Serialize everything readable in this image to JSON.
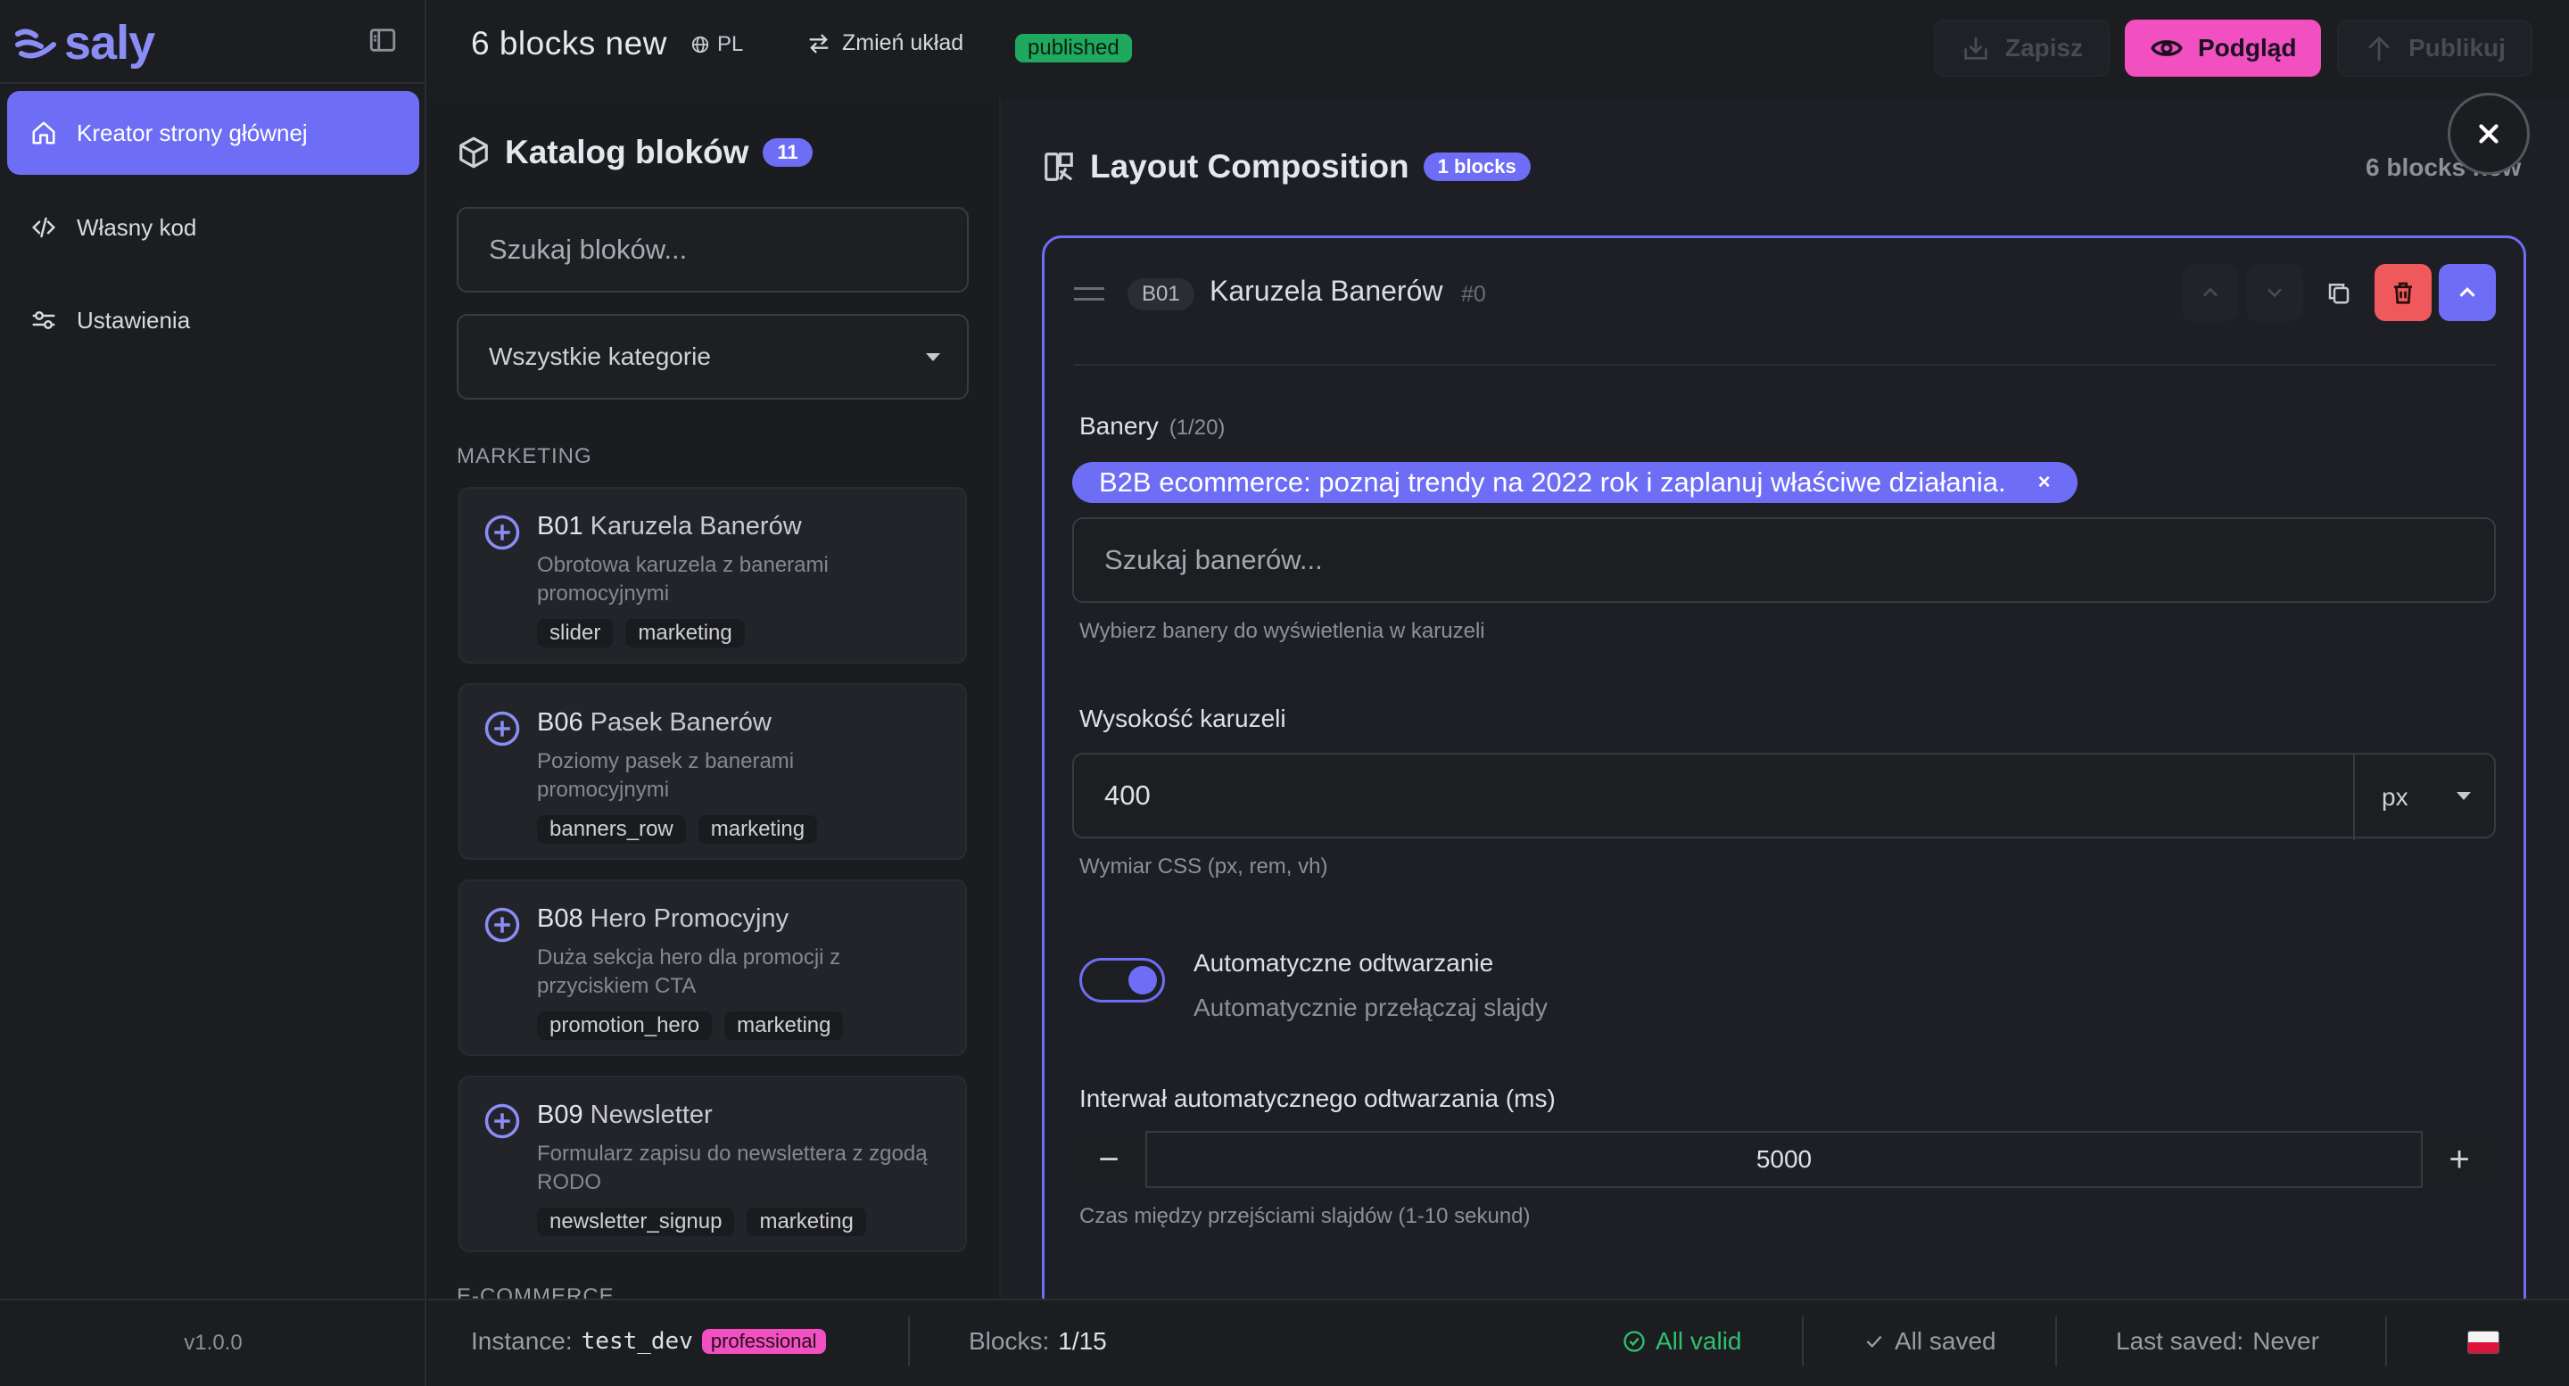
{
  "app": {
    "logo_text": "saly",
    "version": "v1.0.0"
  },
  "sidebar": {
    "items": [
      {
        "label": "Kreator strony głównej",
        "icon": "home-icon",
        "active": true
      },
      {
        "label": "Własny kod",
        "icon": "code-icon",
        "active": false
      },
      {
        "label": "Ustawienia",
        "icon": "sliders-icon",
        "active": false
      }
    ]
  },
  "header": {
    "title": "6 blocks new",
    "language": "PL",
    "change_layout": "Zmień układ",
    "status": "published",
    "save_label": "Zapisz",
    "preview_label": "Podgląd",
    "publish_label": "Publikuj"
  },
  "catalog": {
    "title": "Katalog bloków",
    "count": "11",
    "search_placeholder": "Szukaj bloków...",
    "category_select": "Wszystkie kategorie",
    "section_marketing": "MARKETING",
    "section_ecommerce": "E-COMMERCE",
    "blocks": [
      {
        "code": "B01",
        "name": "Karuzela Banerów",
        "desc": "Obrotowa karuzela z banerami promocyjnymi",
        "tags": [
          "slider",
          "marketing"
        ]
      },
      {
        "code": "B06",
        "name": "Pasek Banerów",
        "desc": "Poziomy pasek z banerami promocyjnymi",
        "tags": [
          "banners_row",
          "marketing"
        ]
      },
      {
        "code": "B08",
        "name": "Hero Promocyjny",
        "desc": "Duża sekcja hero dla promocji z przyciskiem CTA",
        "tags": [
          "promotion_hero",
          "marketing"
        ]
      },
      {
        "code": "B09",
        "name": "Newsletter",
        "desc": "Formularz zapisu do newslettera z zgodą RODO",
        "tags": [
          "newsletter_signup",
          "marketing"
        ]
      }
    ]
  },
  "composition": {
    "title": "Layout Composition",
    "count_badge": "1 blocks",
    "right_text": "6 blocks new",
    "block": {
      "code": "B01",
      "name": "Karuzela Banerów",
      "index": "#0",
      "banners_label": "Banery",
      "banners_count": "(1/20)",
      "banner_chip": "B2B ecommerce: poznaj trendy na 2022 rok i zaplanuj właściwe działania.",
      "banner_chip_remove": "×",
      "banner_search_placeholder": "Szukaj banerów...",
      "banners_hint": "Wybierz banery do wyświetlenia w karuzeli",
      "height_label": "Wysokość karuzeli",
      "height_value": "400",
      "height_unit": "px",
      "height_hint": "Wymiar CSS (px, rem, vh)",
      "autoplay_title": "Automatyczne odtwarzanie",
      "autoplay_sub": "Automatycznie przełączaj slajdy",
      "autoplay_on": true,
      "interval_label": "Interwał automatycznego odtwarzania (ms)",
      "interval_value": "5000",
      "interval_minus": "−",
      "interval_plus": "+",
      "interval_hint": "Czas między przejściami slajdów (1-10 sekund)"
    }
  },
  "footer": {
    "instance_label": "Instance:",
    "instance_value": "test_dev",
    "plan": "professional",
    "blocks_label": "Blocks:",
    "blocks_value": "1/15",
    "valid_text": "All valid",
    "saved_text": "All saved",
    "last_saved_label": "Last saved:",
    "last_saved_value": "Never"
  },
  "colors": {
    "accent": "#6d6ef5",
    "pink": "#f24fc0",
    "danger": "#f0595b",
    "success": "#1fa95e"
  }
}
